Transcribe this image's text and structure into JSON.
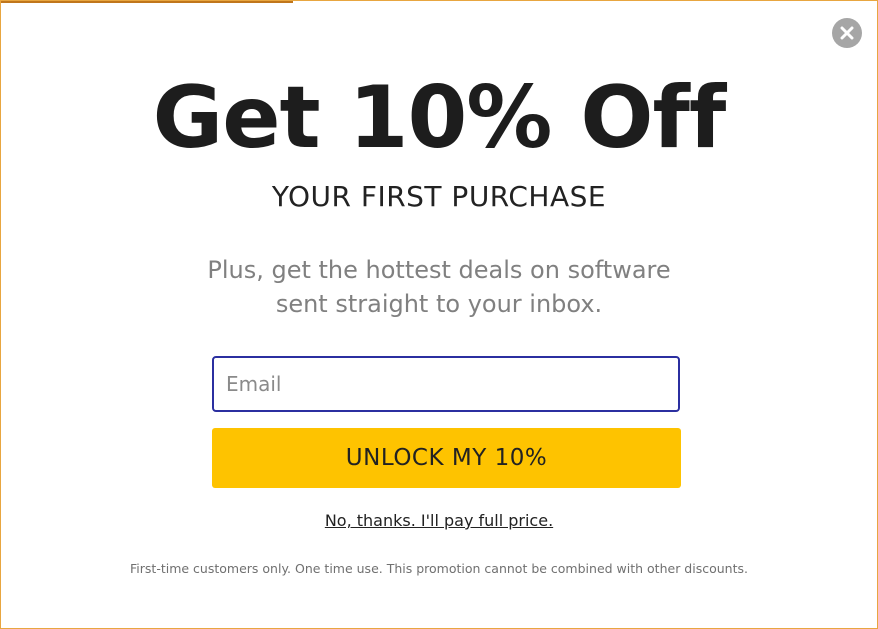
{
  "popup": {
    "headline": "Get 10% Off",
    "subheadline": "YOUR FIRST PURCHASE",
    "pitch_line1": "Plus, get the hottest deals on software",
    "pitch_line2": "sent straight to your inbox.",
    "email_placeholder": "Email",
    "unlock_button_label": "UNLOCK MY 10%",
    "decline_link_label": "No, thanks. I'll pay full price.",
    "disclaimer": "First-time customers only. One time use. This promotion cannot be combined with other discounts.",
    "close_icon": "close-icon"
  },
  "colors": {
    "accent_button": "#fec300",
    "input_border": "#2b2fa0",
    "frame_border": "#e8a640",
    "close_bg": "#a6a6a6"
  }
}
